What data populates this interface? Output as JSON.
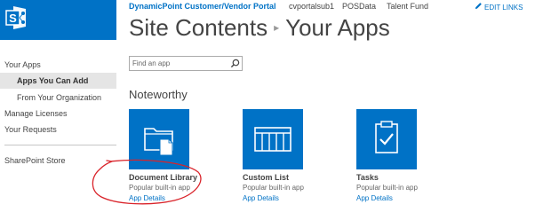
{
  "brand": {
    "accent": "#0072c6",
    "annotation_color": "#d9232a"
  },
  "topnav": {
    "portal": "DynamicPoint Customer/Vendor Portal",
    "links": [
      "cvportalsub1",
      "POSData",
      "Talent Fund"
    ],
    "edit_links": "EDIT LINKS"
  },
  "title": {
    "main": "Site Contents",
    "sub": "Your Apps"
  },
  "leftnav": {
    "items": [
      {
        "label": "Your Apps"
      },
      {
        "label": "Apps You Can Add"
      },
      {
        "label": "From Your Organization"
      },
      {
        "label": "Manage Licenses"
      },
      {
        "label": "Your Requests"
      },
      {
        "label": "SharePoint Store"
      }
    ]
  },
  "search": {
    "placeholder": "Find an app"
  },
  "section": {
    "heading": "Noteworthy"
  },
  "apps": [
    {
      "title": "Document Library",
      "subtitle": "Popular built-in app",
      "details": "App Details",
      "icon": "document-library-icon"
    },
    {
      "title": "Custom List",
      "subtitle": "Popular built-in app",
      "details": "App Details",
      "icon": "custom-list-icon"
    },
    {
      "title": "Tasks",
      "subtitle": "Popular built-in app",
      "details": "App Details",
      "icon": "tasks-icon"
    }
  ]
}
